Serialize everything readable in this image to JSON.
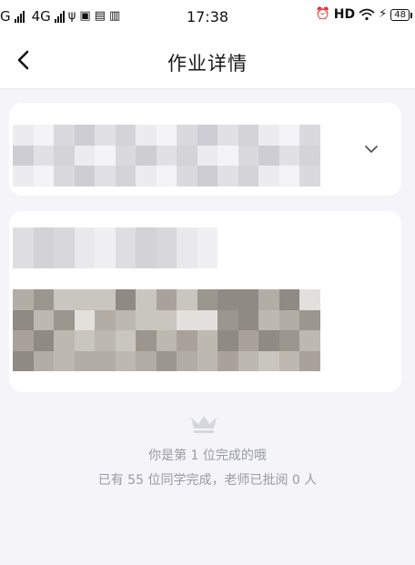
{
  "status_bar": {
    "carrier_left": "G",
    "network_label": "4G",
    "time": "17:38",
    "hd_label": "HD",
    "battery_level": "48"
  },
  "header": {
    "title": "作业详情",
    "back_icon": "chevron-left-icon"
  },
  "cards": {
    "summary_card": {
      "expand_icon": "chevron-down-icon",
      "content_obscured": true
    },
    "content_card": {
      "content_obscured": true
    }
  },
  "completion": {
    "icon": "crown-icon",
    "rank_text": "你是第 1 位完成的哦",
    "stats_text": "已有 55 位同学完成，老师已批阅 0 人"
  },
  "colors": {
    "background": "#f4f4f9",
    "card": "#ffffff",
    "muted_text": "#9a9aa5"
  }
}
